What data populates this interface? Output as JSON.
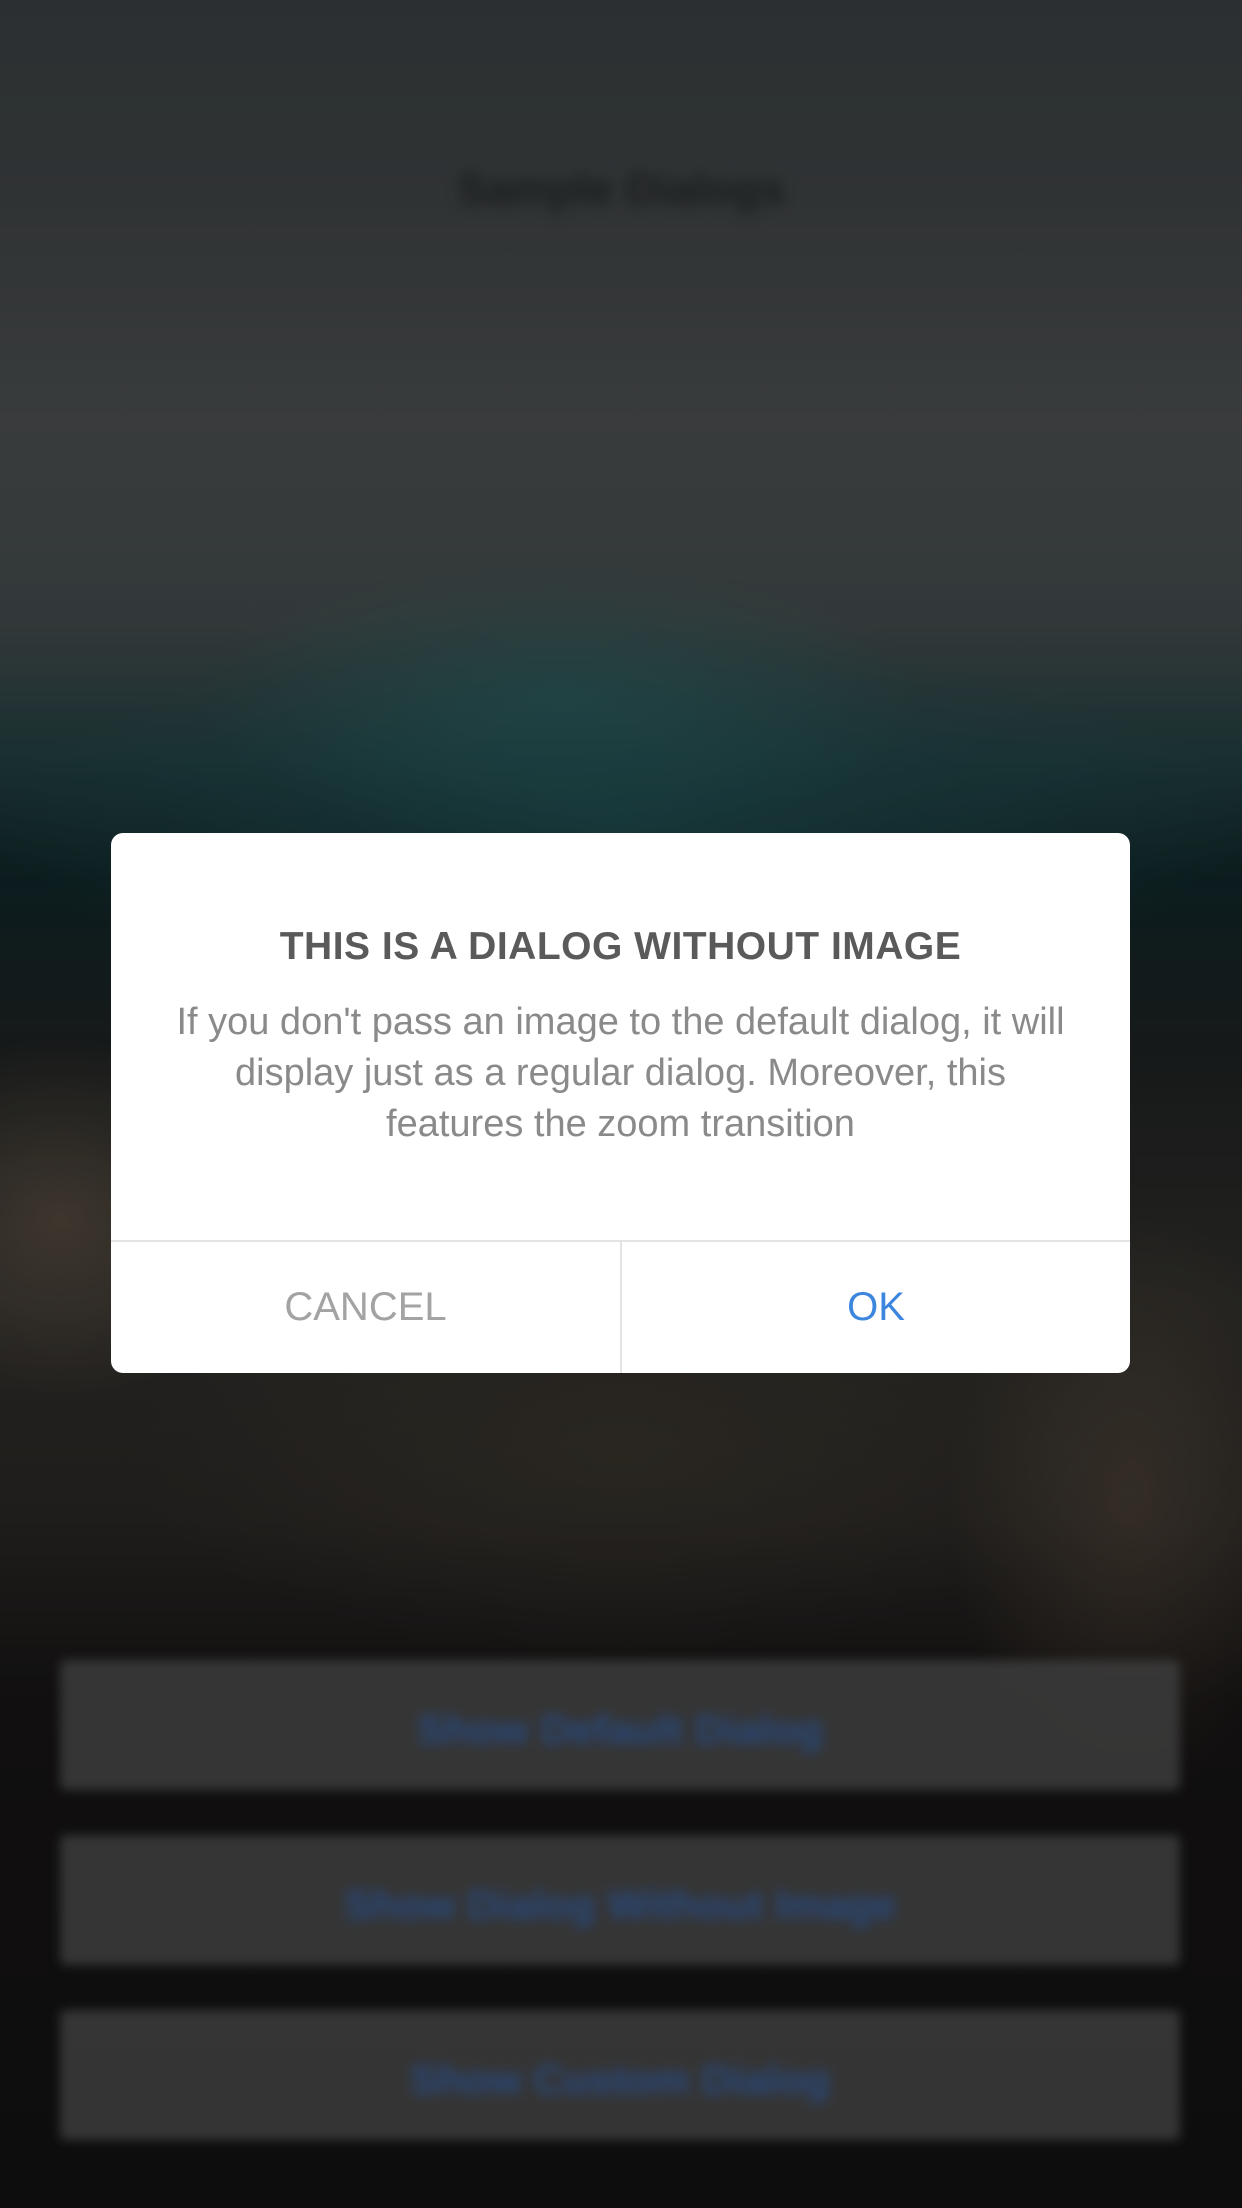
{
  "background": {
    "title": "Sample Dialogs",
    "buttons": [
      {
        "label": "Show Default Dialog"
      },
      {
        "label": "Show Dialog Without Image"
      },
      {
        "label": "Show Custom Dialog"
      }
    ]
  },
  "dialog": {
    "title": "THIS IS A DIALOG WITHOUT IMAGE",
    "message": "If you don't pass an image to the default dialog, it will display just as a regular dialog. Moreover, this features the zoom transition",
    "cancel_label": "CANCEL",
    "ok_label": "OK"
  },
  "colors": {
    "accent": "#3c86de",
    "cancel_text": "#a3a3a3",
    "title_text": "#5a5a5a",
    "message_text": "#8a8a8a"
  }
}
